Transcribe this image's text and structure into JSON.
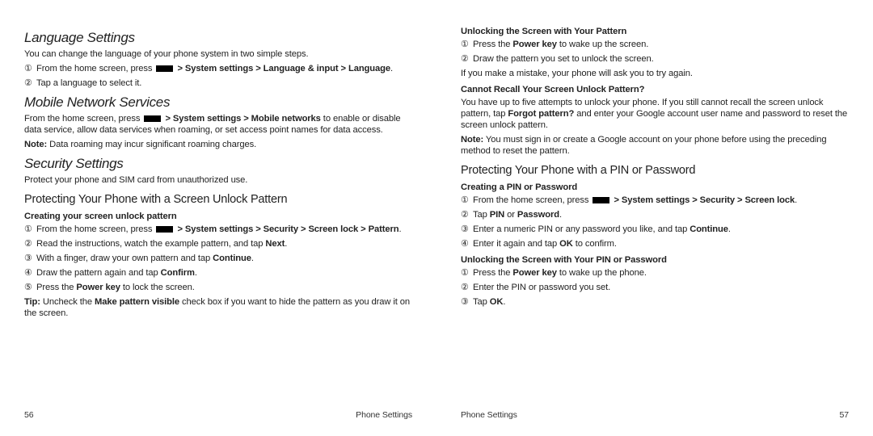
{
  "left": {
    "h1a": "Language Settings",
    "p_lang_intro": "You can change the language of your phone system in two simple steps.",
    "lang_step1_a": "From the home screen, press ",
    "lang_step1_b_bold": "> System settings > Language & input > Language",
    "lang_step1_c": ".",
    "lang_step2": "Tap a language to select it.",
    "h1b": "Mobile Network Services",
    "mob_a": "From the home screen, press ",
    "mob_b_bold": "> System settings > Mobile networks",
    "mob_c": " to enable or disable data service, allow data services when roaming, or set access point names for data access.",
    "mob_note_b": "Note:",
    "mob_note_t": " Data roaming may incur significant roaming charges.",
    "h1c": "Security Settings",
    "sec_intro": "Protect your phone and SIM card from unauthorized use.",
    "h2a": "Protecting Your Phone with a Screen Unlock Pattern",
    "h3a": "Creating your screen unlock pattern",
    "pat1_a": "From the home screen, press ",
    "pat1_b_bold": "> System settings > Security > Screen lock > Pattern",
    "pat1_c": ".",
    "pat2_a": "Read the instructions, watch the example pattern, and tap ",
    "pat2_b": "Next",
    "pat2_c": ".",
    "pat3_a": "With a finger, draw your own pattern and tap ",
    "pat3_b": "Continue",
    "pat3_c": ".",
    "pat4_a": "Draw the pattern again and tap ",
    "pat4_b": "Confirm",
    "pat4_c": ".",
    "pat5_a": "Press the ",
    "pat5_b": "Power key",
    "pat5_c": " to lock the screen.",
    "tip_b": "Tip:",
    "tip_a": " Uncheck the ",
    "tip_bb": "Make pattern visible",
    "tip_c": " check box if you want to hide the pattern as you draw it on the screen.",
    "page_num": "56",
    "footer": "Phone Settings"
  },
  "right": {
    "h3a": "Unlocking the Screen with Your Pattern",
    "u1_a": "Press the ",
    "u1_b": "Power key",
    "u1_c": " to wake up the screen.",
    "u2": "Draw the pattern you set to unlock the screen.",
    "u_after": "If you make a mistake, your phone will ask you to try again.",
    "h3b": "Cannot Recall Your Screen Unlock Pattern?",
    "forgot_a": "You have up to five attempts to unlock your phone. If you still cannot recall the screen unlock pattern, tap ",
    "forgot_b": "Forgot pattern?",
    "forgot_c": " and enter your Google account user name and password to reset the screen unlock pattern.",
    "note_b": "Note:",
    "note_t": " You must sign in or create a Google account on your phone before using the preceding method to reset the pattern.",
    "h2a": "Protecting Your Phone with a PIN or Password",
    "h3c": "Creating a PIN or Password",
    "c1_a": "From the home screen, press ",
    "c1_b_bold": "> System settings > Security > Screen lock",
    "c1_c": ".",
    "c2_a": "Tap ",
    "c2_b": "PIN",
    "c2_c": " or ",
    "c2_d": "Password",
    "c2_e": ".",
    "c3_a": "Enter a numeric PIN or any password you like, and tap ",
    "c3_b": "Continue",
    "c3_c": ".",
    "c4_a": "Enter it again and tap ",
    "c4_b": "OK",
    "c4_c": " to confirm.",
    "h3d": "Unlocking the Screen with Your PIN or Password",
    "p1_a": "Press the ",
    "p1_b": "Power key",
    "p1_c": " to wake up the phone.",
    "p2": "Enter the PIN or password you set.",
    "p3_a": "Tap ",
    "p3_b": "OK",
    "p3_c": ".",
    "footer": "Phone Settings",
    "page_num": "57"
  },
  "circled": {
    "1": "①",
    "2": "②",
    "3": "③",
    "4": "④",
    "5": "⑤"
  }
}
